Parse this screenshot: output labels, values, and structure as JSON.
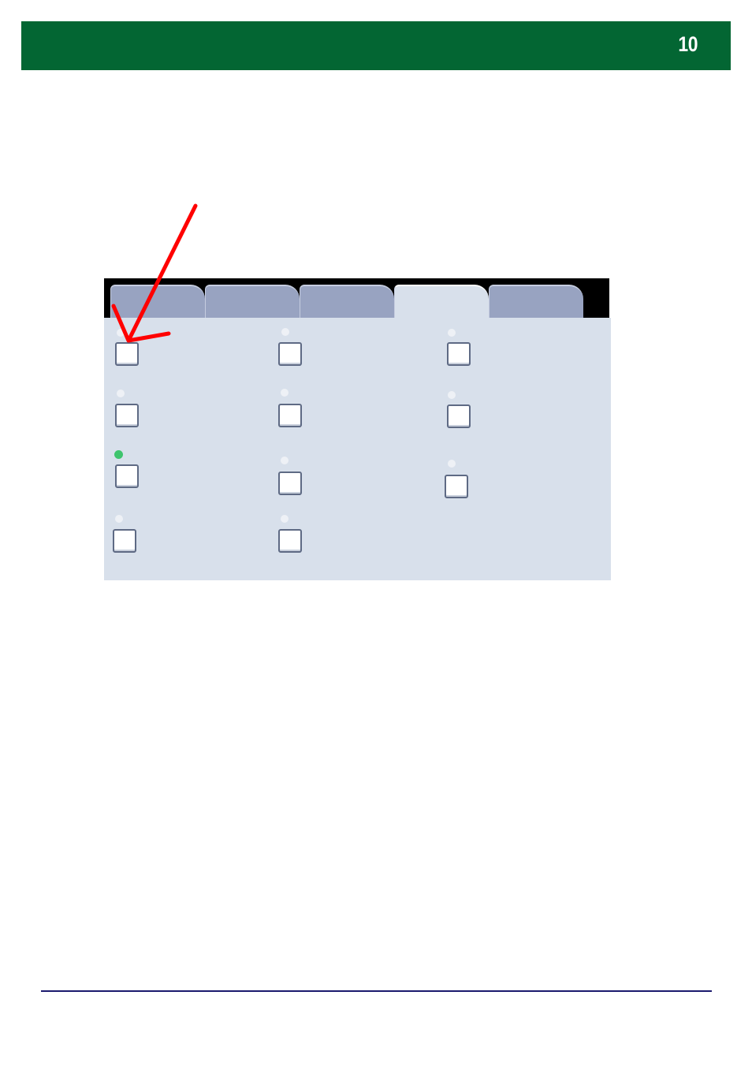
{
  "header": {
    "page_number": "10",
    "color": "#036633"
  },
  "screen": {
    "tabs": [
      {
        "id": "tab-1",
        "active": false
      },
      {
        "id": "tab-2",
        "active": false
      },
      {
        "id": "tab-3",
        "active": false
      },
      {
        "id": "tab-4",
        "active": true
      },
      {
        "id": "tab-5",
        "active": false
      }
    ],
    "options": [
      {
        "id": "col1-row1",
        "indicator": "off",
        "checked": false
      },
      {
        "id": "col1-row2",
        "indicator": "off",
        "checked": false
      },
      {
        "id": "col1-row3",
        "indicator": "on",
        "checked": false
      },
      {
        "id": "col1-row4",
        "indicator": "off",
        "checked": false
      },
      {
        "id": "col2-row1",
        "indicator": "off",
        "checked": false
      },
      {
        "id": "col2-row2",
        "indicator": "off",
        "checked": false
      },
      {
        "id": "col2-row3",
        "indicator": "off",
        "checked": false
      },
      {
        "id": "col2-row4",
        "indicator": "off",
        "checked": false
      },
      {
        "id": "col3-row1",
        "indicator": "off",
        "checked": false
      },
      {
        "id": "col3-row2",
        "indicator": "off",
        "checked": false
      },
      {
        "id": "col3-row3",
        "indicator": "off",
        "checked": false
      }
    ],
    "indicator_on_color": "#3ec46d"
  },
  "annotation": {
    "icon": "red-arrow-icon",
    "color": "#ff0000",
    "points_to": "col1-row1"
  },
  "footer": {
    "rule_color": "#1b1a6e"
  }
}
